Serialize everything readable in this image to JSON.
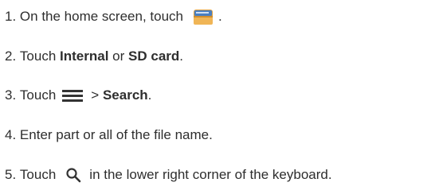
{
  "steps": [
    {
      "number": "1.",
      "before": "On the home screen, touch",
      "icon": "file-manager-folder-icon",
      "after": "."
    },
    {
      "number": "2.",
      "before": "Touch",
      "bold1": "Internal",
      "middle": "or",
      "bold2": "SD card",
      "after": "."
    },
    {
      "number": "3.",
      "before": "Touch",
      "icon": "menu-icon",
      "middle": ">",
      "bold1": "Search",
      "after": "."
    },
    {
      "number": "4.",
      "text": "Enter part or all of the file name."
    },
    {
      "number": "5.",
      "before": "Touch",
      "icon": "search-icon",
      "after": "in the lower right corner of the keyboard."
    }
  ],
  "colors": {
    "text": "#2e2e2e",
    "folder_body": "#e8a84a",
    "folder_screen": "#4a7fc0"
  }
}
